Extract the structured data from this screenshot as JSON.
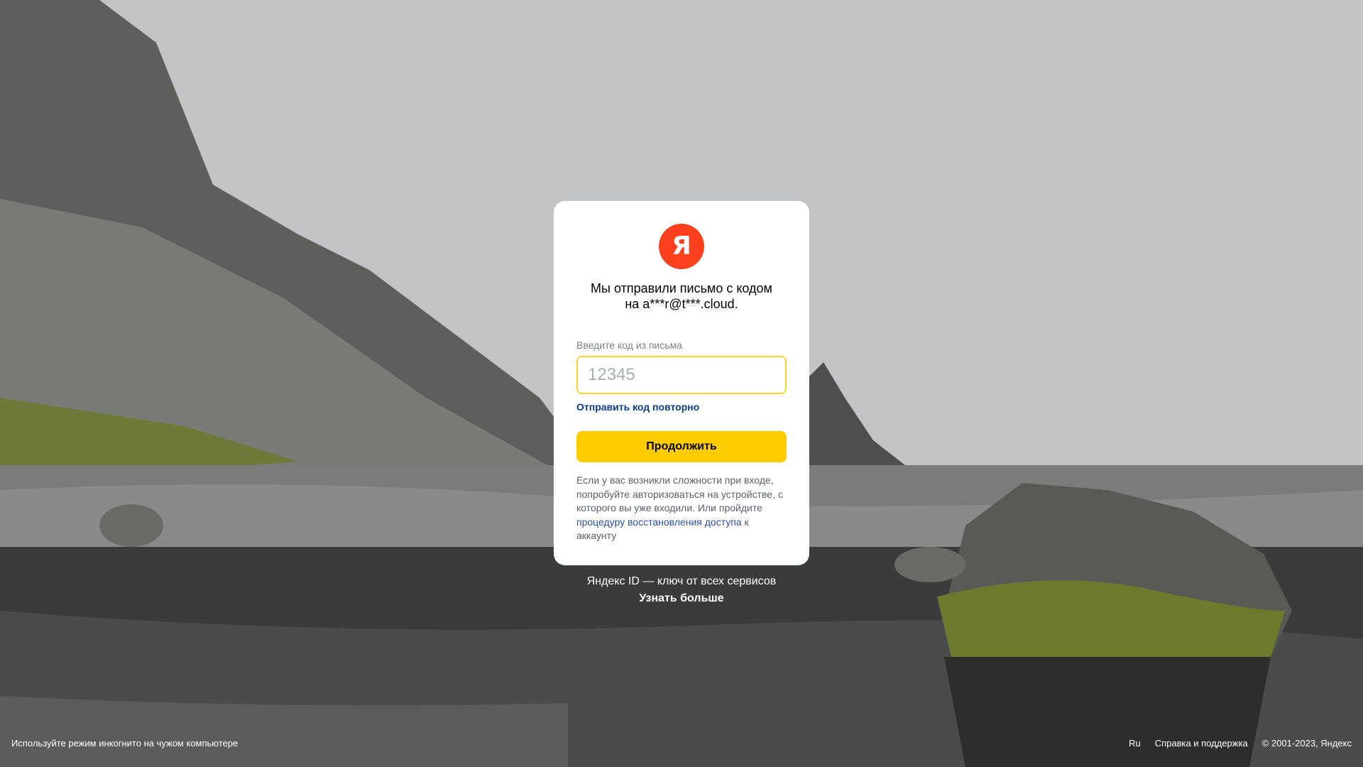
{
  "brand": {
    "logo_letter": "Я",
    "logo_color": "#fc3f1d"
  },
  "card": {
    "title_line1": "Мы отправили письмо с кодом",
    "title_line2": "на a***r@t***.cloud.",
    "code_label": "Введите код из письма",
    "code_placeholder": "12345",
    "code_value": "",
    "resend_link": "Отправить код повторно",
    "continue_button": "Продолжить",
    "help_text_before": "Если у вас возникли сложности при входе, попробуйте авторизоваться на устройстве, с которого вы уже входили. Или пройдите ",
    "help_link": "процедуру восстановления доступа",
    "help_text_after": " к аккаунту"
  },
  "promo": {
    "text": "Яндекс ID — ключ от всех сервисов",
    "link": "Узнать больше"
  },
  "footer": {
    "incognito_tip": "Используйте режим инкогнито на чужом компьютере",
    "language": "Ru",
    "support": "Справка и поддержка",
    "copyright": "© 2001-2023, Яндекс"
  },
  "colors": {
    "accent_yellow": "#ffcc00",
    "input_border": "#fed42b",
    "link_blue": "#0a3d91"
  }
}
